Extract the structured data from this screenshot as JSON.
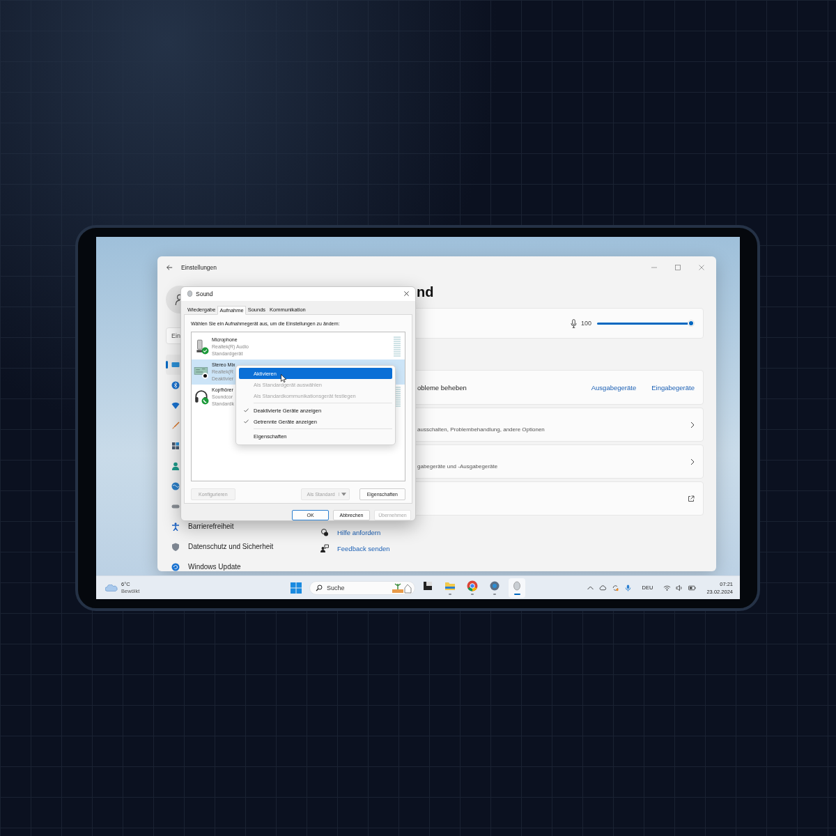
{
  "settings": {
    "title": "Einstellungen",
    "search": {
      "placeholder": "Ein"
    },
    "nav": [
      {
        "selected": true
      },
      {
        "selected": false
      },
      {
        "selected": false
      },
      {
        "selected": false
      },
      {
        "selected": false
      },
      {
        "selected": false
      },
      {
        "selected": false
      },
      {
        "selected": false
      },
      {
        "label": "Barrierefreiheit",
        "selected": false
      },
      {
        "label": "Datenschutz und Sicherheit",
        "selected": false
      },
      {
        "label": "Windows Update",
        "selected": false
      }
    ],
    "heading": "nd",
    "volume": {
      "value": "100",
      "level": 1
    },
    "troubleshoot": {
      "label": "obleme beheben",
      "links": [
        "Ausgabegeräte",
        "Eingabegeräte"
      ]
    },
    "rows": [
      {
        "subtitle": "ausschalten, Problembehandlung, andere Optionen",
        "kind": "chevron"
      },
      {
        "subtitle": "gabegeräte und -Ausgabegeräte",
        "kind": "chevron"
      },
      {
        "kind": "external"
      }
    ],
    "help_links": [
      "Hilfe anfordern",
      "Feedback senden"
    ]
  },
  "dialog": {
    "title": "Sound",
    "tabs": [
      {
        "label": "Wiedergabe",
        "selected": false
      },
      {
        "label": "Aufnahme",
        "selected": true
      },
      {
        "label": "Sounds",
        "selected": false
      },
      {
        "label": "Kommunikation",
        "selected": false
      }
    ],
    "instruction": "Wählen Sie ein Aufnahmegerät aus, um die Einstellungen zu ändern:",
    "devices": [
      {
        "name": "Microphone",
        "driver": "Realtek(R) Audio",
        "status": "Standardgerät",
        "kind": "default",
        "selected": false
      },
      {
        "name": "Stereo Mix",
        "driver": "Realtek(R",
        "status": "Deaktivier",
        "kind": "disabled",
        "selected": true
      },
      {
        "name": "Kopfhörer",
        "driver": "Soundcor",
        "status": "Standardk",
        "kind": "communication",
        "selected": false
      }
    ],
    "actions": [
      {
        "label": "Konfigurieren",
        "kind": "plain",
        "disabled": true
      },
      {
        "label": "Als Standard",
        "kind": "split",
        "disabled": true
      },
      {
        "label": "Eigenschaften",
        "kind": "plain",
        "disabled": false
      }
    ],
    "footer": [
      {
        "label": "OK",
        "default": true,
        "disabled": false
      },
      {
        "label": "Abbrechen",
        "default": false,
        "disabled": false
      },
      {
        "label": "Übernehmen",
        "default": false,
        "disabled": true
      }
    ]
  },
  "context_menu": [
    {
      "kind": "item",
      "label": "Aktivieren",
      "highlighted": true,
      "disabled": false,
      "checked": false
    },
    {
      "kind": "item",
      "label": "Als Standardgerät auswählen",
      "highlighted": false,
      "disabled": true,
      "checked": false
    },
    {
      "kind": "item",
      "label": "Als Standardkommunikationsgerät festlegen",
      "highlighted": false,
      "disabled": true,
      "checked": false
    },
    {
      "kind": "separator"
    },
    {
      "kind": "item",
      "label": "Deaktivierte Geräte anzeigen",
      "highlighted": false,
      "disabled": false,
      "checked": true
    },
    {
      "kind": "item",
      "label": "Getrennte Geräte anzeigen",
      "highlighted": false,
      "disabled": false,
      "checked": true
    },
    {
      "kind": "separator"
    },
    {
      "kind": "item",
      "label": "Eigenschaften",
      "highlighted": false,
      "disabled": false,
      "checked": false
    }
  ],
  "taskbar": {
    "weather": {
      "temperature": "6°C",
      "condition": "Bewölkt"
    },
    "search": {
      "placeholder": "Suche"
    },
    "apps": [
      {
        "running": false,
        "active": false
      },
      {
        "running": true,
        "active": false
      },
      {
        "running": true,
        "active": false
      },
      {
        "running": true,
        "active": false
      },
      {
        "running": true,
        "active": true
      }
    ],
    "language": "DEU",
    "time": "07:21",
    "date": "23.02.2024"
  }
}
